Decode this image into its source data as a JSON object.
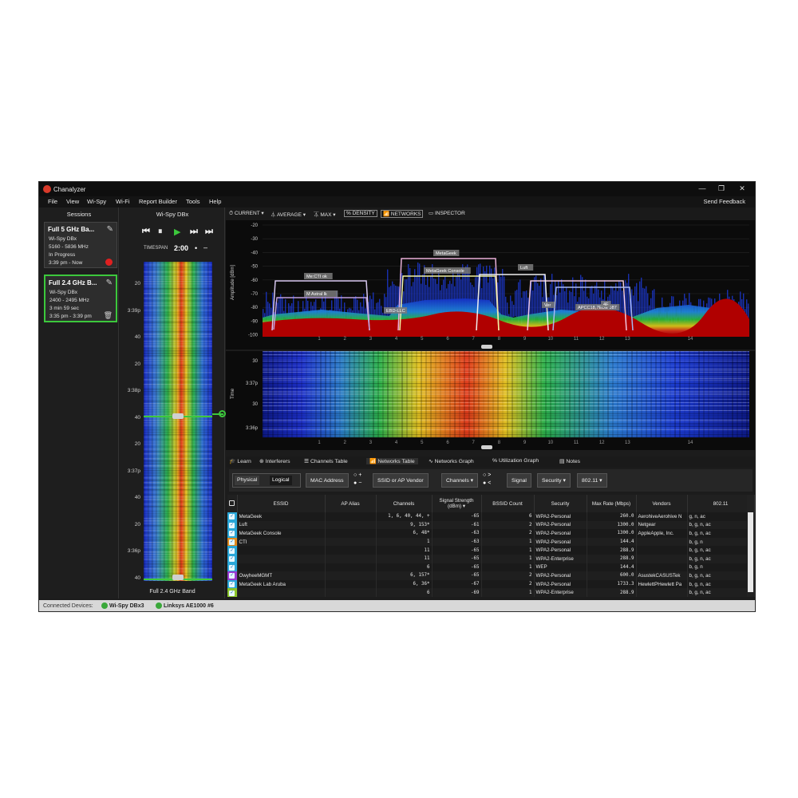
{
  "app": {
    "title": "Chanalyzer",
    "minimize": "—",
    "restore": "❐",
    "close": "✕"
  },
  "menu": [
    "File",
    "View",
    "Wi-Spy",
    "Wi-Fi",
    "Report Builder",
    "Tools",
    "Help"
  ],
  "send_feedback": "Send Feedback",
  "sessions": {
    "title": "Sessions",
    "cards": [
      {
        "title": "Full 5 GHz Ba...",
        "lines": [
          "Wi-Spy DBx",
          "5160 - 5836 MHz",
          "In Progress",
          "3:39 pm - Now"
        ]
      },
      {
        "title": "Full 2.4 GHz B...",
        "lines": [
          "Wi-Spy DBx",
          "2400 - 2495 MHz",
          "3 min 59 sec",
          "3:35 pm - 3:39 pm"
        ]
      }
    ]
  },
  "wispy": {
    "title": "Wi-Spy DBx",
    "timespan_label": "TIMESPAN",
    "timespan_value": "2:00",
    "band_label": "Full 2.4 GHz Band",
    "ticks": [
      "20",
      "3:39p",
      "40",
      "20",
      "3:38p",
      "40",
      "20",
      "3:37p",
      "40",
      "20",
      "3:36p",
      "40"
    ]
  },
  "toolbar": {
    "current": "CURRENT",
    "average": "AVERAGE",
    "max": "MAX",
    "density": "DENSITY",
    "networks": "NETWORKS",
    "inspector": "INSPECTOR"
  },
  "spectrum": {
    "y_label": "Amplitude [dBm]",
    "y_ticks": [
      "-20",
      "-30",
      "-40",
      "-50",
      "-60",
      "-70",
      "-80",
      "-90",
      "-100"
    ],
    "channels": [
      "1",
      "2",
      "3",
      "4",
      "5",
      "6",
      "7",
      "8",
      "9",
      "10",
      "11",
      "12",
      "13",
      "14"
    ],
    "network_labels": [
      "MetaGeek",
      "MetaGeek Console",
      "Luft",
      "Me:CTI ok",
      "M Astral lk",
      "EBD-LLC",
      "APCC18,7EDE 387",
      "Ver",
      "4F"
    ]
  },
  "waterfall": {
    "y_label": "Time",
    "y_ticks": [
      "30",
      "3:37p",
      "30",
      "3:36p"
    ]
  },
  "tabs": [
    "Learn",
    "Interferers",
    "Channels Table",
    "Networks Table",
    "Networks Graph",
    "Utilization Graph",
    "Notes"
  ],
  "filters": {
    "physical": "Physical",
    "logical": "Logical",
    "mac": "MAC Address",
    "ssid": "SSID or AP Vendor",
    "channels": "Channels",
    "signal": "Signal",
    "security": "Security",
    "standard": "802.11",
    "plus": "+",
    "minus": "−",
    "gt": ">",
    "lt": "<"
  },
  "table": {
    "headers": [
      "",
      "ESSID",
      "AP Alias",
      "Channels",
      "Signal Strength (dBm)",
      "BSSID Count",
      "Security",
      "Max Rate (Mbps)",
      "Vendors",
      "802.11"
    ],
    "rows": [
      {
        "color": "#2aa7d8",
        "essid": "MetaGeek",
        "channels": "1, 6, 40, 44, +",
        "signal": "-65",
        "bssid": "6",
        "security": "WPA2-Personal",
        "rate": "260.0",
        "vendor": "AerohiveAerohive N",
        "std": "g, n, ac"
      },
      {
        "color": "#2aa7d8",
        "essid": "Luft",
        "channels": "9, 153*",
        "signal": "-61",
        "bssid": "2",
        "security": "WPA2-Personal",
        "rate": "1300.0",
        "vendor": "Netgear",
        "std": "b, g, n, ac"
      },
      {
        "color": "#2aa7d8",
        "essid": "MetaGeek Console",
        "channels": "6, 48*",
        "signal": "-63",
        "bssid": "2",
        "security": "WPA2-Personal",
        "rate": "1300.0",
        "vendor": "AppleApple, Inc.",
        "std": "b, g, n, ac"
      },
      {
        "color": "#e08a1e",
        "essid": "CTI",
        "channels": "1",
        "signal": "-63",
        "bssid": "1",
        "security": "WPA2-Personal",
        "rate": "144.4",
        "vendor": "",
        "std": "b, g, n"
      },
      {
        "color": "#2aa7d8",
        "essid": "",
        "channels": "11",
        "signal": "-65",
        "bssid": "1",
        "security": "WPA2-Personal",
        "rate": "288.9",
        "vendor": "",
        "std": "b, g, n, ac"
      },
      {
        "color": "#2aa7d8",
        "essid": "",
        "channels": "11",
        "signal": "-65",
        "bssid": "1",
        "security": "WPA2-Enterprise",
        "rate": "288.9",
        "vendor": "",
        "std": "b, g, n, ac"
      },
      {
        "color": "#2aa7d8",
        "essid": "",
        "channels": "6",
        "signal": "-65",
        "bssid": "1",
        "security": "WEP",
        "rate": "144.4",
        "vendor": "",
        "std": "b, g, n"
      },
      {
        "color": "#9a3ad0",
        "essid": "OwyheeMGMT",
        "channels": "6, 157*",
        "signal": "-65",
        "bssid": "2",
        "security": "WPA2-Personal",
        "rate": "600.0",
        "vendor": "AsustekCASUSTek",
        "std": "b, g, n, ac"
      },
      {
        "color": "#2aa7d8",
        "essid": "MetaGeek Lab Aruba",
        "channels": "6, 36*",
        "signal": "-67",
        "bssid": "2",
        "security": "WPA2-Personal",
        "rate": "1733.3",
        "vendor": "HewlettPHewlett Pa",
        "std": "b, g, n, ac"
      },
      {
        "color": "#8ac42a",
        "essid": "",
        "channels": "6",
        "signal": "-69",
        "bssid": "1",
        "security": "WPA2-Enterprise",
        "rate": "288.9",
        "vendor": "",
        "std": "b, g, n, ac"
      }
    ]
  },
  "status": {
    "label": "Connected Devices:",
    "devices": [
      "Wi-Spy DBx3",
      "Linksys AE1000 #6"
    ]
  },
  "colors": {
    "accent_green": "#3cc83c",
    "record_red": "#e02020",
    "trace_red": "#cc0000"
  }
}
